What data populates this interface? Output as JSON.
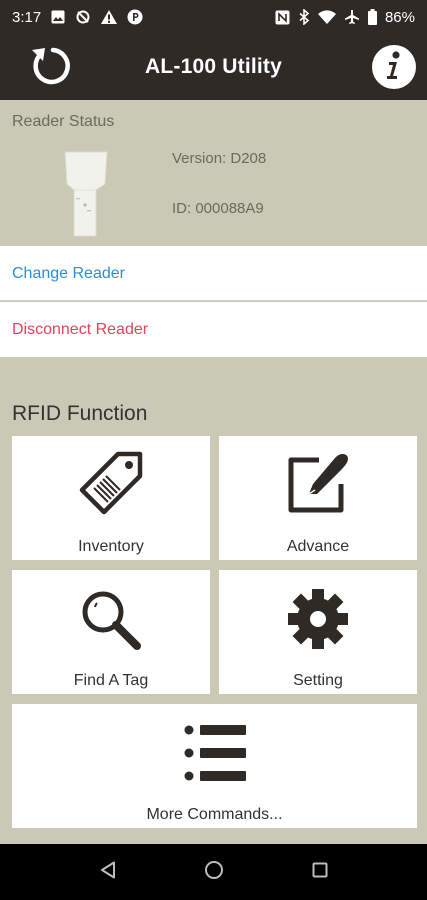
{
  "status_bar": {
    "time": "3:17",
    "battery": "86%",
    "icons_left": [
      "image-icon",
      "sync-icon",
      "warning-icon",
      "parking-icon"
    ],
    "icons_right": [
      "nfc-icon",
      "bluetooth-icon",
      "wifi-icon",
      "airplane-icon",
      "battery-icon"
    ]
  },
  "app_bar": {
    "title": "AL-100 Utility",
    "left_icon": "refresh-icon",
    "right_icon": "info-icon"
  },
  "reader_status": {
    "label": "Reader Status",
    "version": "Version: D208",
    "id": "ID: 000088A9"
  },
  "actions": {
    "change_reader": "Change Reader",
    "disconnect_reader": "Disconnect Reader"
  },
  "rfid": {
    "heading": "RFID Function",
    "tiles": [
      {
        "label": "Inventory",
        "icon": "tag-icon"
      },
      {
        "label": "Advance",
        "icon": "edit-icon"
      },
      {
        "label": "Find A Tag",
        "icon": "magnifier-icon"
      },
      {
        "label": "Setting",
        "icon": "gear-icon"
      },
      {
        "label": "More Commands...",
        "icon": "list-icon"
      }
    ]
  },
  "colors": {
    "app_bar": "#2f2a26",
    "background": "#c9c9b5",
    "link_blue": "#2a8fd8",
    "link_red": "#e0455a"
  }
}
